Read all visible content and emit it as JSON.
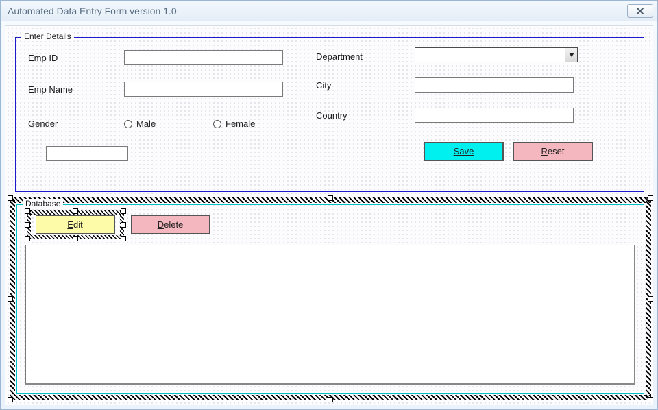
{
  "window": {
    "title": "Automated Data Entry Form version 1.0"
  },
  "details": {
    "legend": "Enter Details",
    "emp_id_label": "Emp ID",
    "emp_name_label": "Emp Name",
    "gender_label": "Gender",
    "gender_male": "Male",
    "gender_female": "Female",
    "department_label": "Department",
    "city_label": "City",
    "country_label": "Country",
    "emp_id_value": "",
    "emp_name_value": "",
    "city_value": "",
    "country_value": "",
    "department_value": "",
    "extra_value": ""
  },
  "buttons": {
    "save": "Save",
    "reset": "Reset",
    "edit": "Edit",
    "delete": "Delete"
  },
  "database": {
    "legend": "Database"
  }
}
